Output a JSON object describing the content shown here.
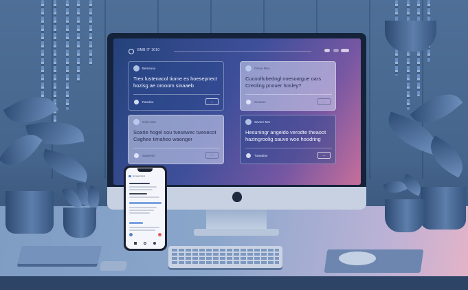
{
  "screen": {
    "app_title": "BMB IT 1010",
    "cards": [
      {
        "author": "Bemaoou",
        "question": "Trex lustenacol tiome es hoesepnect hozisg ae orooom sinaaeb",
        "footer": "Paoulee",
        "button": "—",
        "theme": "dark"
      },
      {
        "author": "Orene Mea",
        "question": "Cucoolfubedngl noesoatgue oars Creoling pnouer hosley?",
        "footer": "Srseeas",
        "button": "—",
        "theme": "light"
      },
      {
        "author": "Orde Moe",
        "question": "Soarie hogel sou tvesewec tueoecot Caghee timaheo waonger",
        "footer": "Saweeds",
        "button": "—",
        "theme": "light"
      },
      {
        "author": "Sevore Mer",
        "question": "Hesuningr angeido verodte theaoot hazingroolig sauve woe hoodring",
        "footer": "Tuawalue",
        "button": "—",
        "theme": "dark"
      }
    ]
  },
  "phone": {
    "header": "Hnnsonnrat A"
  },
  "colors": {
    "screen_gradient_start": "#24427a",
    "screen_gradient_end": "#c76f9a",
    "wall": "#4e6f97",
    "desk": "#8aa6cb"
  }
}
